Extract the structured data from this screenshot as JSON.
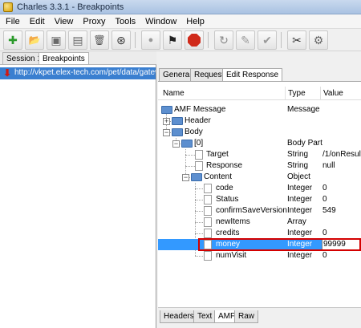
{
  "window": {
    "title": "Charles 3.3.1 - Breakpoints"
  },
  "menu": [
    "File",
    "Edit",
    "View",
    "Proxy",
    "Tools",
    "Window",
    "Help"
  ],
  "toolbar": {
    "buttons": [
      {
        "name": "new-session-icon",
        "glyph": "✚"
      },
      {
        "name": "open-session-icon",
        "glyph": "📂"
      },
      {
        "name": "close-session-icon",
        "glyph": "▣"
      },
      {
        "name": "save-session-icon",
        "glyph": "▤"
      },
      {
        "name": "clear-session-icon",
        "glyph": "🗑"
      },
      {
        "name": "find-icon",
        "glyph": "⊛"
      },
      {
        "name": "record-icon",
        "glyph": "●"
      },
      {
        "name": "throttle-icon",
        "glyph": "⚑"
      },
      {
        "name": "breakpoints-icon",
        "glyph": ""
      },
      {
        "name": "repeat-icon",
        "glyph": "↻"
      },
      {
        "name": "edit-icon",
        "glyph": "✎"
      },
      {
        "name": "validate-icon",
        "glyph": "✔"
      },
      {
        "name": "tools-icon",
        "glyph": "✂"
      },
      {
        "name": "settings-icon",
        "glyph": "⚙"
      }
    ]
  },
  "sessions": {
    "tabs": [
      "Session 1",
      "Breakpoints"
    ]
  },
  "left": {
    "url": "http://vkpet.elex-tech.com/pet/data/gatew"
  },
  "right": {
    "tabs": [
      "General",
      "Request",
      "Edit Response"
    ],
    "columns": {
      "name": "Name",
      "type": "Type",
      "value": "Value"
    },
    "rows": [
      {
        "name": "AMF Message",
        "type": "Message",
        "value": ""
      },
      {
        "name": "Header",
        "type": "",
        "value": ""
      },
      {
        "name": "Body",
        "type": "",
        "value": ""
      },
      {
        "name": "[0]",
        "type": "Body Part",
        "value": ""
      },
      {
        "name": "Target",
        "type": "String",
        "value": "/1/onResult"
      },
      {
        "name": "Response",
        "type": "String",
        "value": "null"
      },
      {
        "name": "Content",
        "type": "Object",
        "value": ""
      },
      {
        "name": "code",
        "type": "Integer",
        "value": "0"
      },
      {
        "name": "Status",
        "type": "Integer",
        "value": "0"
      },
      {
        "name": "confirmSaveVersion",
        "type": "Integer",
        "value": "549"
      },
      {
        "name": "newItems",
        "type": "Array",
        "value": ""
      },
      {
        "name": "credits",
        "type": "Integer",
        "value": "0"
      },
      {
        "name": "money",
        "type": "Integer",
        "value": "99999"
      },
      {
        "name": "numVisit",
        "type": "Integer",
        "value": "0"
      }
    ],
    "bottom_tabs": [
      "Headers",
      "Text",
      "AMF",
      "Raw"
    ]
  },
  "colors": {
    "selection": "#3399ff",
    "url_row": "#3a7fd0",
    "highlight": "#d40000",
    "stop": "#d02a1a"
  }
}
